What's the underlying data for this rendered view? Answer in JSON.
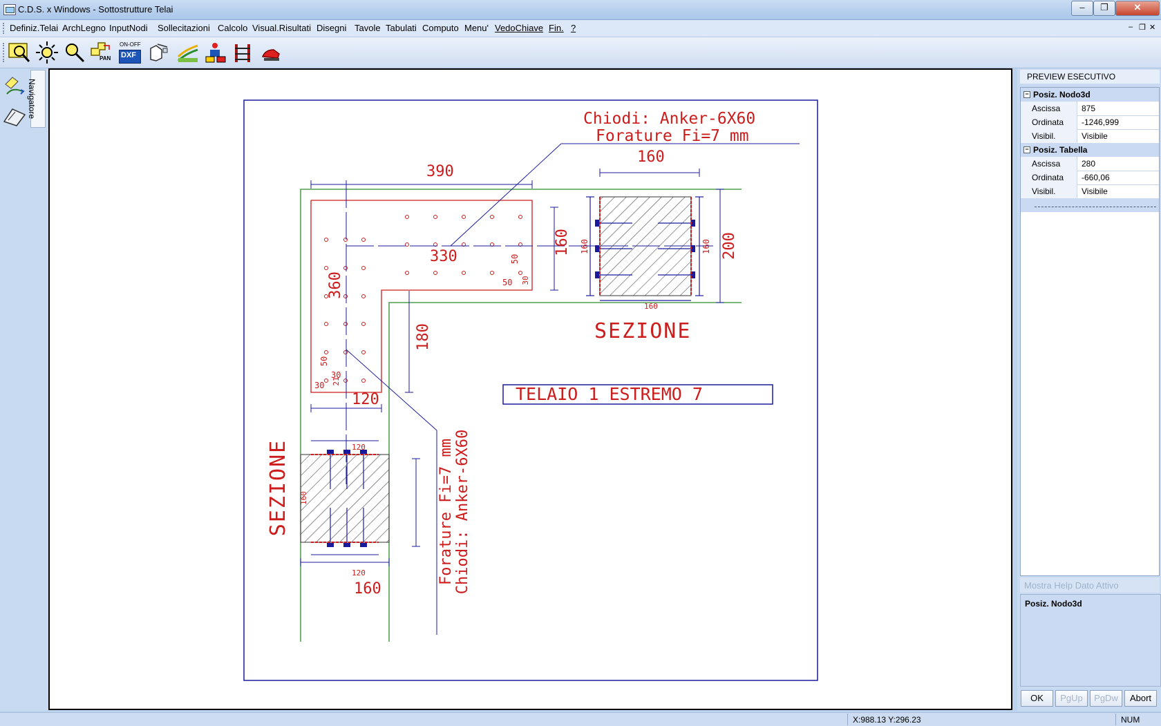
{
  "window": {
    "title": "C.D.S. x Windows - Sottostrutture Telai"
  },
  "menu": [
    "Definiz.Telai",
    "ArchLegno",
    "InputNodi",
    "Sollecitazioni",
    "Calcolo",
    "Visual.Risultati",
    "Disegni",
    "Tavole",
    "Tabulati",
    "Computo",
    "Menu'",
    "VedoChiave",
    "Fin.",
    "?"
  ],
  "toolbar": {
    "tools": [
      "zoom-window-icon",
      "zoom-all-icon",
      "zoom-icon",
      "pan-icon",
      "dxf-toggle-icon",
      "select-icon",
      "layer-icon",
      "node-icon",
      "frame-icon",
      "print-icon"
    ],
    "pan_label": "PAN",
    "dxf_label": "DXF",
    "onoff_label": "ON-OFF"
  },
  "navigator": {
    "label": "Navigatore"
  },
  "drawing": {
    "nails": "Chiodi: Anker-6X60",
    "holes": "Forature Fi=7 mm",
    "section": "SEZIONE",
    "frame": "TELAIO 1 ESTREMO 7",
    "dims": {
      "d390": "390",
      "d160": "160",
      "d200": "200",
      "d330": "330",
      "d360": "360",
      "d180": "180",
      "d120": "120",
      "d50": "50",
      "d30": "30",
      "d21": "21"
    }
  },
  "preview": {
    "header": "PREVIEW ESECUTIVO",
    "groups": [
      {
        "title": "Posiz. Nodo3d",
        "rows": [
          {
            "k": "Ascissa",
            "v": "875"
          },
          {
            "k": "Ordinata",
            "v": "-1246,999"
          },
          {
            "k": "Visibil.",
            "v": "Visibile"
          }
        ]
      },
      {
        "title": "Posiz. Tabella",
        "rows": [
          {
            "k": "Ascissa",
            "v": "280"
          },
          {
            "k": "Ordinata",
            "v": "-660,06"
          },
          {
            "k": "Visibil.",
            "v": "Visibile"
          }
        ]
      }
    ],
    "help_caption": "Mostra Help Dato Attivo",
    "help_text": "Posiz. Nodo3d"
  },
  "buttons": {
    "ok": "OK",
    "pgup": "PgUp",
    "pgdw": "PgDw",
    "abort": "Abort"
  },
  "status": {
    "coords": "X:988.13  Y:296.23",
    "num": "NUM"
  },
  "colors": {
    "drawing_red": "#cc1c1c",
    "drawing_blue": "#1a1a9c",
    "drawing_green": "#2c8c2c",
    "panel": "#c7daf1"
  }
}
